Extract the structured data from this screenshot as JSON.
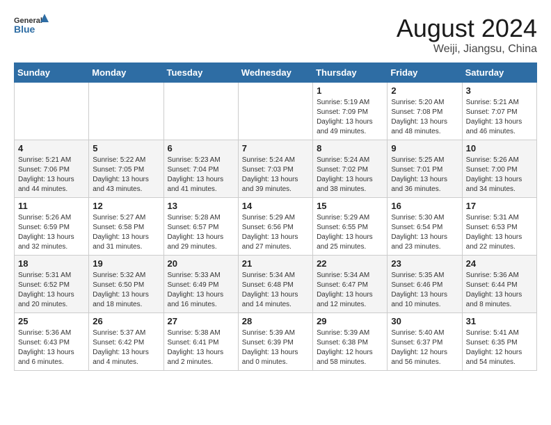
{
  "header": {
    "logo_general": "General",
    "logo_blue": "Blue",
    "month_title": "August 2024",
    "location": "Weiji, Jiangsu, China"
  },
  "weekdays": [
    "Sunday",
    "Monday",
    "Tuesday",
    "Wednesday",
    "Thursday",
    "Friday",
    "Saturday"
  ],
  "weeks": [
    [
      {
        "day": "",
        "info": ""
      },
      {
        "day": "",
        "info": ""
      },
      {
        "day": "",
        "info": ""
      },
      {
        "day": "",
        "info": ""
      },
      {
        "day": "1",
        "info": "Sunrise: 5:19 AM\nSunset: 7:09 PM\nDaylight: 13 hours\nand 49 minutes."
      },
      {
        "day": "2",
        "info": "Sunrise: 5:20 AM\nSunset: 7:08 PM\nDaylight: 13 hours\nand 48 minutes."
      },
      {
        "day": "3",
        "info": "Sunrise: 5:21 AM\nSunset: 7:07 PM\nDaylight: 13 hours\nand 46 minutes."
      }
    ],
    [
      {
        "day": "4",
        "info": "Sunrise: 5:21 AM\nSunset: 7:06 PM\nDaylight: 13 hours\nand 44 minutes."
      },
      {
        "day": "5",
        "info": "Sunrise: 5:22 AM\nSunset: 7:05 PM\nDaylight: 13 hours\nand 43 minutes."
      },
      {
        "day": "6",
        "info": "Sunrise: 5:23 AM\nSunset: 7:04 PM\nDaylight: 13 hours\nand 41 minutes."
      },
      {
        "day": "7",
        "info": "Sunrise: 5:24 AM\nSunset: 7:03 PM\nDaylight: 13 hours\nand 39 minutes."
      },
      {
        "day": "8",
        "info": "Sunrise: 5:24 AM\nSunset: 7:02 PM\nDaylight: 13 hours\nand 38 minutes."
      },
      {
        "day": "9",
        "info": "Sunrise: 5:25 AM\nSunset: 7:01 PM\nDaylight: 13 hours\nand 36 minutes."
      },
      {
        "day": "10",
        "info": "Sunrise: 5:26 AM\nSunset: 7:00 PM\nDaylight: 13 hours\nand 34 minutes."
      }
    ],
    [
      {
        "day": "11",
        "info": "Sunrise: 5:26 AM\nSunset: 6:59 PM\nDaylight: 13 hours\nand 32 minutes."
      },
      {
        "day": "12",
        "info": "Sunrise: 5:27 AM\nSunset: 6:58 PM\nDaylight: 13 hours\nand 31 minutes."
      },
      {
        "day": "13",
        "info": "Sunrise: 5:28 AM\nSunset: 6:57 PM\nDaylight: 13 hours\nand 29 minutes."
      },
      {
        "day": "14",
        "info": "Sunrise: 5:29 AM\nSunset: 6:56 PM\nDaylight: 13 hours\nand 27 minutes."
      },
      {
        "day": "15",
        "info": "Sunrise: 5:29 AM\nSunset: 6:55 PM\nDaylight: 13 hours\nand 25 minutes."
      },
      {
        "day": "16",
        "info": "Sunrise: 5:30 AM\nSunset: 6:54 PM\nDaylight: 13 hours\nand 23 minutes."
      },
      {
        "day": "17",
        "info": "Sunrise: 5:31 AM\nSunset: 6:53 PM\nDaylight: 13 hours\nand 22 minutes."
      }
    ],
    [
      {
        "day": "18",
        "info": "Sunrise: 5:31 AM\nSunset: 6:52 PM\nDaylight: 13 hours\nand 20 minutes."
      },
      {
        "day": "19",
        "info": "Sunrise: 5:32 AM\nSunset: 6:50 PM\nDaylight: 13 hours\nand 18 minutes."
      },
      {
        "day": "20",
        "info": "Sunrise: 5:33 AM\nSunset: 6:49 PM\nDaylight: 13 hours\nand 16 minutes."
      },
      {
        "day": "21",
        "info": "Sunrise: 5:34 AM\nSunset: 6:48 PM\nDaylight: 13 hours\nand 14 minutes."
      },
      {
        "day": "22",
        "info": "Sunrise: 5:34 AM\nSunset: 6:47 PM\nDaylight: 13 hours\nand 12 minutes."
      },
      {
        "day": "23",
        "info": "Sunrise: 5:35 AM\nSunset: 6:46 PM\nDaylight: 13 hours\nand 10 minutes."
      },
      {
        "day": "24",
        "info": "Sunrise: 5:36 AM\nSunset: 6:44 PM\nDaylight: 13 hours\nand 8 minutes."
      }
    ],
    [
      {
        "day": "25",
        "info": "Sunrise: 5:36 AM\nSunset: 6:43 PM\nDaylight: 13 hours\nand 6 minutes."
      },
      {
        "day": "26",
        "info": "Sunrise: 5:37 AM\nSunset: 6:42 PM\nDaylight: 13 hours\nand 4 minutes."
      },
      {
        "day": "27",
        "info": "Sunrise: 5:38 AM\nSunset: 6:41 PM\nDaylight: 13 hours\nand 2 minutes."
      },
      {
        "day": "28",
        "info": "Sunrise: 5:39 AM\nSunset: 6:39 PM\nDaylight: 13 hours\nand 0 minutes."
      },
      {
        "day": "29",
        "info": "Sunrise: 5:39 AM\nSunset: 6:38 PM\nDaylight: 12 hours\nand 58 minutes."
      },
      {
        "day": "30",
        "info": "Sunrise: 5:40 AM\nSunset: 6:37 PM\nDaylight: 12 hours\nand 56 minutes."
      },
      {
        "day": "31",
        "info": "Sunrise: 5:41 AM\nSunset: 6:35 PM\nDaylight: 12 hours\nand 54 minutes."
      }
    ]
  ]
}
